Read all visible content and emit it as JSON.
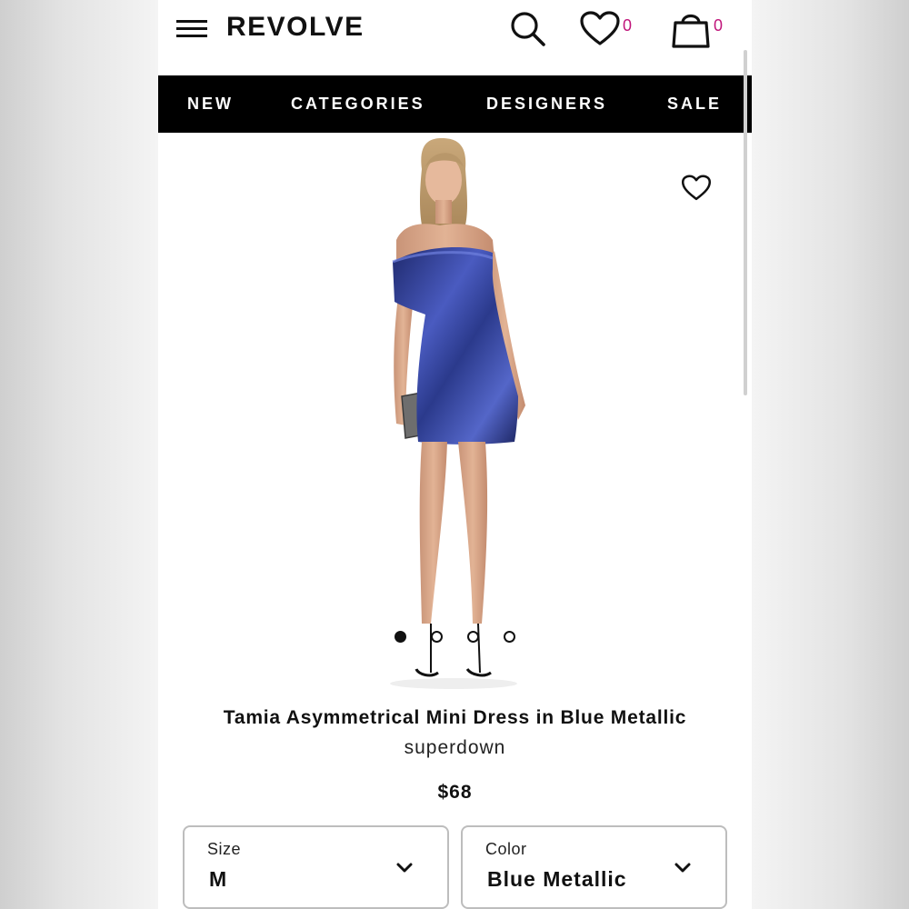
{
  "header": {
    "logo": "REVOLVE",
    "wishlist_count": "0",
    "bag_count": "0"
  },
  "nav": {
    "items": [
      {
        "label": "NEW"
      },
      {
        "label": "CATEGORIES"
      },
      {
        "label": "DESIGNERS"
      },
      {
        "label": "SALE"
      }
    ]
  },
  "gallery": {
    "image_count": 4,
    "active_index": 0
  },
  "product": {
    "title": "Tamia Asymmetrical Mini Dress in Blue Metallic",
    "brand": "superdown",
    "price": "$68"
  },
  "options": {
    "size": {
      "label": "Size",
      "value": "M"
    },
    "color": {
      "label": "Color",
      "value": "Blue Metallic"
    }
  },
  "colors": {
    "accent_count": "#c0157a",
    "nav_bg": "#000000",
    "dress": "#2b3a8c"
  }
}
